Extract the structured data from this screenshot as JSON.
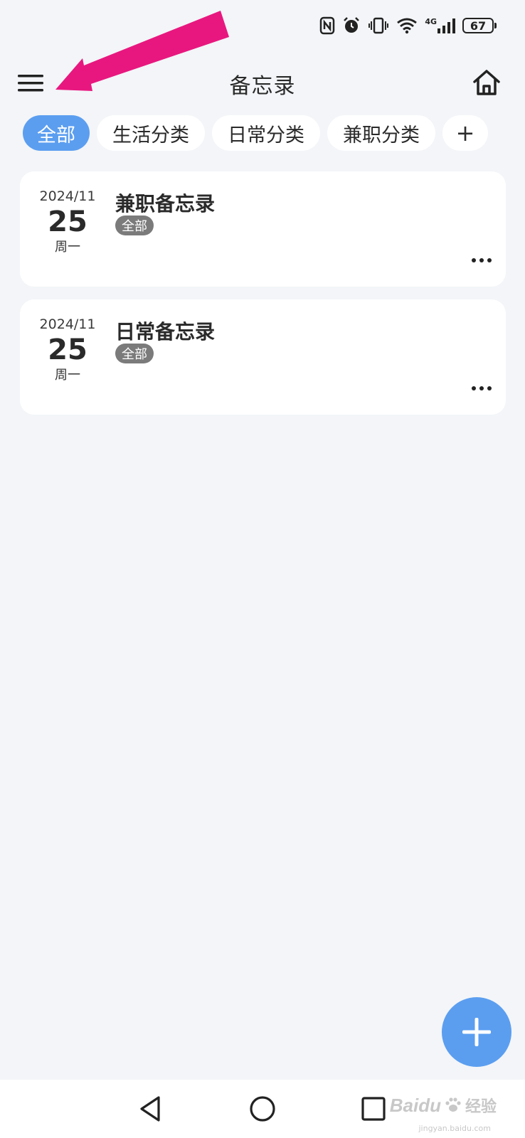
{
  "status_bar": {
    "network_label": "4G",
    "battery_level": "67"
  },
  "header": {
    "title": "备忘录"
  },
  "tabs": [
    {
      "label": "全部",
      "active": true
    },
    {
      "label": "生活分类",
      "active": false
    },
    {
      "label": "日常分类",
      "active": false
    },
    {
      "label": "兼职分类",
      "active": false
    },
    {
      "label": "+",
      "active": false
    }
  ],
  "memos": [
    {
      "year_month": "2024/11",
      "day": "25",
      "weekday": "周一",
      "title": "兼职备忘录",
      "tag": "全部"
    },
    {
      "year_month": "2024/11",
      "day": "25",
      "weekday": "周一",
      "title": "日常备忘录",
      "tag": "全部"
    }
  ],
  "watermark": {
    "brand": "Baidu",
    "suffix": "经验",
    "url": "jingyan.baidu.com"
  },
  "colors": {
    "accent": "#5b9ef0",
    "background": "#f3f5f8",
    "annotation": "#e8177f",
    "tag_bg": "#7b7b7b"
  }
}
